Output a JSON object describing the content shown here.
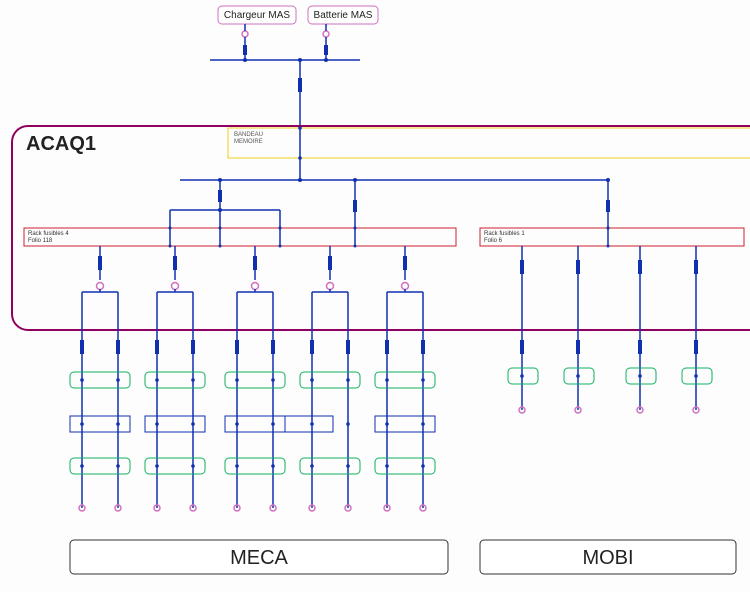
{
  "top_blocks": {
    "charger": "Chargeur MAS",
    "battery": "Batterie MAS"
  },
  "container": {
    "title": "ACAQ1"
  },
  "memory_block": {
    "line1": "BANDEAU",
    "line2": "MEMOIRE"
  },
  "racks": {
    "left": {
      "title": "Rack fusibles 4",
      "subtitle": "Folio 118"
    },
    "right": {
      "title": "Rack fusibles 1",
      "subtitle": "Folio 6"
    }
  },
  "footers": {
    "left": "MECA",
    "right": "MOBI"
  }
}
